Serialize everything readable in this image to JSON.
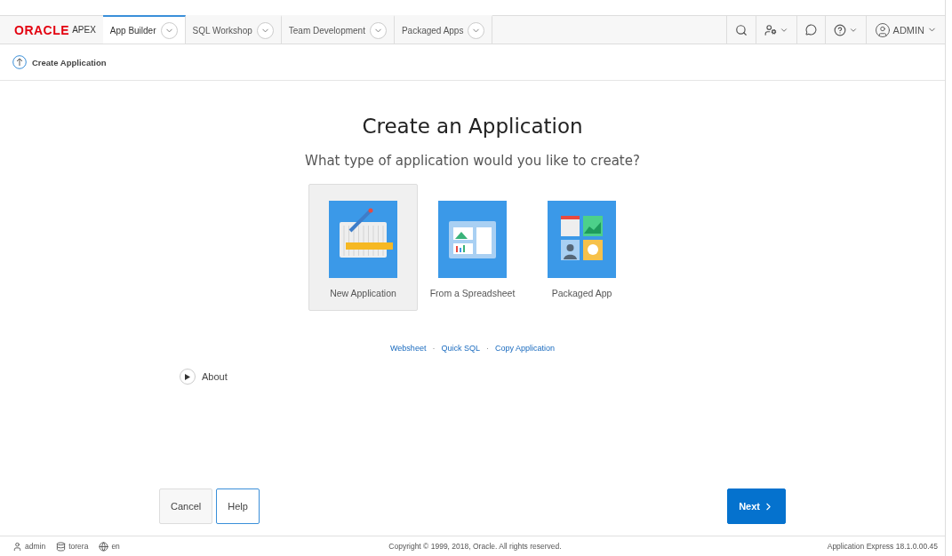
{
  "header": {
    "logo": {
      "brand": "ORACLE",
      "product": "APEX"
    },
    "tabs": [
      {
        "label": "App Builder",
        "selected": true
      },
      {
        "label": "SQL Workshop",
        "selected": false
      },
      {
        "label": "Team Development",
        "selected": false
      },
      {
        "label": "Packaged Apps",
        "selected": false
      }
    ],
    "user": "ADMIN"
  },
  "breadcrumb": {
    "title": "Create Application"
  },
  "heading": "Create an Application",
  "subheading": "What type of application would you like to create?",
  "options": [
    {
      "kind": "new",
      "label": "New Application",
      "selected": true
    },
    {
      "kind": "spreadsheet",
      "label": "From a Spreadsheet",
      "selected": false
    },
    {
      "kind": "packaged",
      "label": "Packaged App",
      "selected": false
    }
  ],
  "links": {
    "separator": "·",
    "items": [
      "Websheet",
      "Quick SQL",
      "Copy Application"
    ]
  },
  "about": {
    "label": "About",
    "expanded": false
  },
  "buttons": {
    "cancel": "Cancel",
    "help": "Help",
    "next": "Next"
  },
  "footer": {
    "user": "admin",
    "workspace": "torera",
    "language": "en",
    "copyright": "Copyright © 1999, 2018, Oracle. All rights reserved.",
    "version": "Application Express 18.1.0.00.45"
  }
}
